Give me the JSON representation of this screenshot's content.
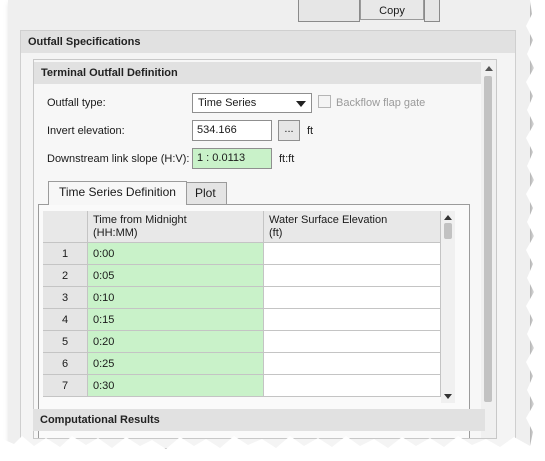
{
  "top_tabs": {
    "copy_label": "Copy"
  },
  "outfall_specifications": {
    "header": "Outfall Specifications",
    "terminal_outfall": {
      "header": "Terminal Outfall Definition",
      "outfall_type_label": "Outfall type:",
      "outfall_type_value": "Time Series",
      "backflow_label": "Backflow flap gate",
      "backflow_checked": false,
      "invert_elevation_label": "Invert elevation:",
      "invert_elevation_value": "534.166",
      "browse_label": "...",
      "invert_unit": "ft",
      "downstream_slope_label": "Downstream link slope (H:V):",
      "downstream_slope_value": "1 : 0.0113",
      "slope_unit": "ft:ft"
    },
    "tabs": [
      {
        "label": "Time Series Definition",
        "active": true
      },
      {
        "label": "Plot",
        "active": false
      }
    ],
    "grid": {
      "columns": [
        {
          "line1": "Time from Midnight",
          "line2": "(HH:MM)"
        },
        {
          "line1": "Water Surface Elevation",
          "line2": "(ft)"
        }
      ],
      "rows": [
        {
          "num": "1",
          "time": "0:00",
          "wse": ""
        },
        {
          "num": "2",
          "time": "0:05",
          "wse": ""
        },
        {
          "num": "3",
          "time": "0:10",
          "wse": ""
        },
        {
          "num": "4",
          "time": "0:15",
          "wse": ""
        },
        {
          "num": "5",
          "time": "0:20",
          "wse": ""
        },
        {
          "num": "6",
          "time": "0:25",
          "wse": ""
        },
        {
          "num": "7",
          "time": "0:30",
          "wse": ""
        }
      ]
    },
    "computational_results_header": "Computational Results"
  },
  "colors": {
    "input_green": "#c9f2c9",
    "section_header": "#e1e1e1"
  }
}
